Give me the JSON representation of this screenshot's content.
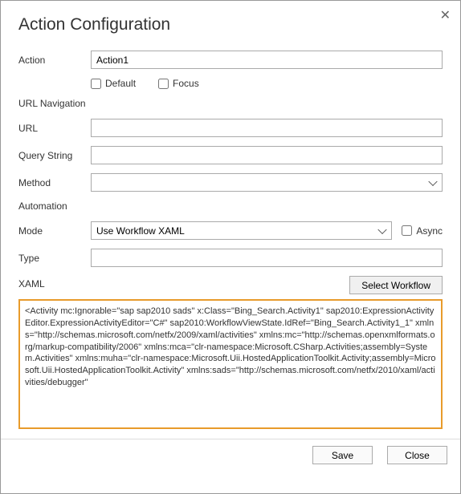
{
  "dialog": {
    "title": "Action Configuration",
    "close_glyph": "✕"
  },
  "labels": {
    "action": "Action",
    "default": "Default",
    "focus": "Focus",
    "url_nav": "URL Navigation",
    "url": "URL",
    "query_string": "Query String",
    "method": "Method",
    "automation": "Automation",
    "mode": "Mode",
    "async": "Async",
    "type": "Type",
    "xaml": "XAML",
    "select_workflow": "Select Workflow",
    "save": "Save",
    "close": "Close"
  },
  "values": {
    "action": "Action1",
    "default_checked": false,
    "focus_checked": false,
    "url": "",
    "query_string": "",
    "method": "",
    "mode": "Use Workflow XAML",
    "async_checked": false,
    "type": "",
    "xaml_text": "<Activity mc:Ignorable=\"sap sap2010 sads\" x:Class=\"Bing_Search.Activity1\" sap2010:ExpressionActivityEditor.ExpressionActivityEditor=\"C#\" sap2010:WorkflowViewState.IdRef=\"Bing_Search.Activity1_1\"\n xmlns=\"http://schemas.microsoft.com/netfx/2009/xaml/activities\"\n xmlns:mc=\"http://schemas.openxmlformats.org/markup-compatibility/2006\"\n xmlns:mca=\"clr-namespace:Microsoft.CSharp.Activities;assembly=System.Activities\"\n xmlns:muha=\"clr-namespace:Microsoft.Uii.HostedApplicationToolkit.Activity;assembly=Microsoft.Uii.HostedApplicationToolkit.Activity\"\n xmlns:sads=\"http://schemas.microsoft.com/netfx/2010/xaml/activities/debugger\""
  }
}
